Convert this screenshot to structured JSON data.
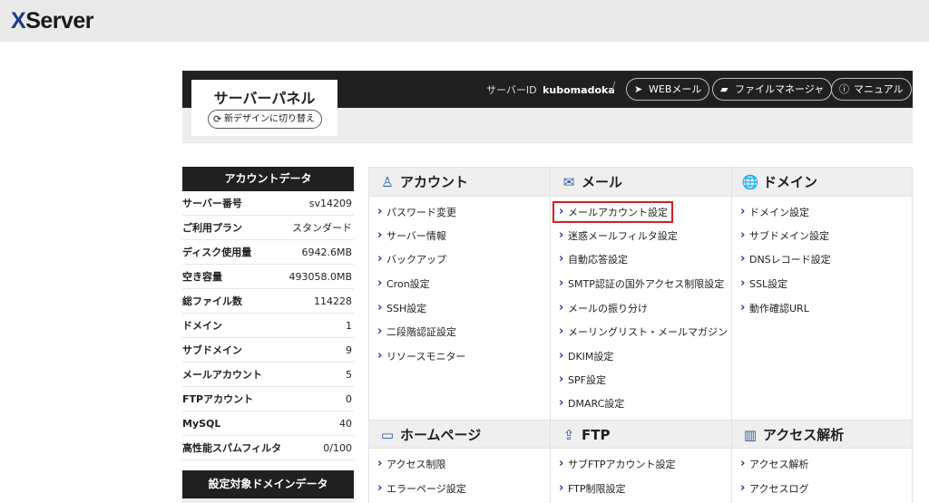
{
  "app": {
    "logo": "XServer",
    "logo_x": "X",
    "logo_rest": "Server"
  },
  "header": {
    "title": "サーバーパネル",
    "switch_label": "新デザインに切り替え",
    "server_id_label": "サーバーID",
    "server_id_value": "kubomadoka",
    "separator": "/",
    "webmail_label": "WEBメール",
    "filemanager_label": "ファイルマネージャ",
    "manual_label": "マニュアル"
  },
  "account_data": {
    "title": "アカウントデータ",
    "rows": [
      {
        "key": "サーバー番号",
        "value": "sv14209"
      },
      {
        "key": "ご利用プラン",
        "value": "スタンダード"
      },
      {
        "key": "ディスク使用量",
        "value": "6942.6MB"
      },
      {
        "key": "空き容量",
        "value": "493058.0MB"
      },
      {
        "key": "総ファイル数",
        "value": "114228"
      },
      {
        "key": "ドメイン",
        "value": "1"
      },
      {
        "key": "サブドメイン",
        "value": "9"
      },
      {
        "key": "メールアカウント",
        "value": "5"
      },
      {
        "key": "FTPアカウント",
        "value": "0"
      },
      {
        "key": "MySQL",
        "value": "40"
      },
      {
        "key": "高性能スパムフィルタ",
        "value": "0/100"
      }
    ],
    "domain_data_title": "設定対象ドメインデータ"
  },
  "sections": {
    "account": {
      "title": "アカウント",
      "icon": "user-icon",
      "items": [
        "パスワード変更",
        "サーバー情報",
        "バックアップ",
        "Cron設定",
        "SSH設定",
        "二段階認証設定",
        "リソースモニター"
      ]
    },
    "mail": {
      "title": "メール",
      "icon": "envelope-icon",
      "items": [
        "メールアカウント設定",
        "迷惑メールフィルタ設定",
        "自動応答設定",
        "SMTP認証の国外アクセス制限設定",
        "メールの振り分け",
        "メーリングリスト・メールマガジン",
        "DKIM設定",
        "SPF設定",
        "DMARC設定"
      ]
    },
    "domain": {
      "title": "ドメイン",
      "icon": "globe-icon",
      "items": [
        "ドメイン設定",
        "サブドメイン設定",
        "DNSレコード設定",
        "SSL設定",
        "動作確認URL"
      ]
    },
    "homepage": {
      "title": "ホームページ",
      "icon": "browser-window-icon",
      "items": [
        "アクセス制限",
        "エラーページ設定"
      ]
    },
    "ftp": {
      "title": "FTP",
      "icon": "upload-icon",
      "items": [
        "サブFTPアカウント設定",
        "FTP制限設定"
      ]
    },
    "access": {
      "title": "アクセス解析",
      "icon": "bar-chart-icon",
      "items": [
        "アクセス解析",
        "アクセスログ"
      ]
    }
  },
  "colors": {
    "accent": "#1d3a8a",
    "highlight": "#d0202a",
    "header_dark": "#202020"
  }
}
